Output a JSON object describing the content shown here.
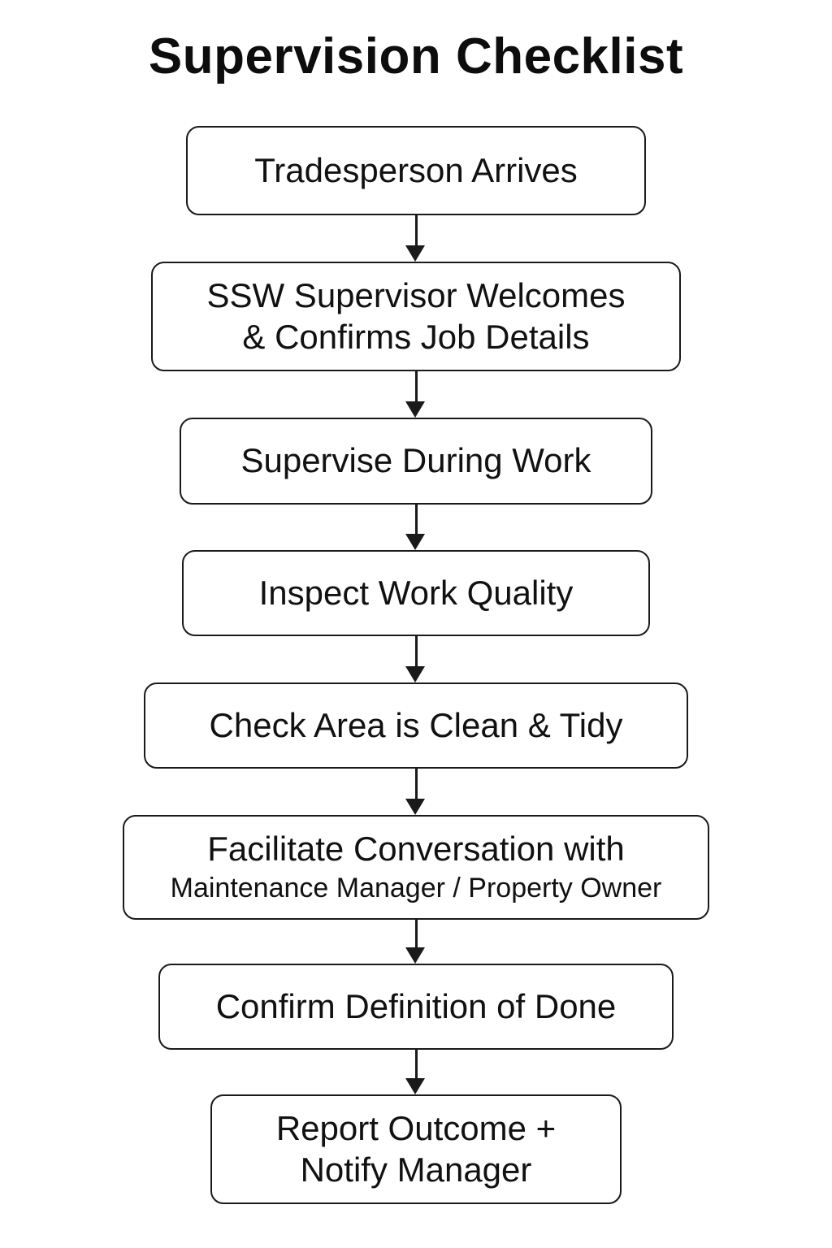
{
  "title": "Supervision Checklist",
  "steps": [
    {
      "lines": [
        "Tradesperson Arrives"
      ]
    },
    {
      "lines": [
        "SSW Supervisor Welcomes",
        "& Confirms Job Details"
      ]
    },
    {
      "lines": [
        "Supervise During Work"
      ]
    },
    {
      "lines": [
        "Inspect Work Quality"
      ]
    },
    {
      "lines": [
        "Check Area is Clean & Tidy"
      ]
    },
    {
      "lines": [
        "Facilitate Conversation with",
        "Maintenance Manager / Property Owner"
      ]
    },
    {
      "lines": [
        "Confirm Definition of Done"
      ]
    },
    {
      "lines": [
        "Report Outcome +",
        "Notify Manager"
      ]
    }
  ]
}
